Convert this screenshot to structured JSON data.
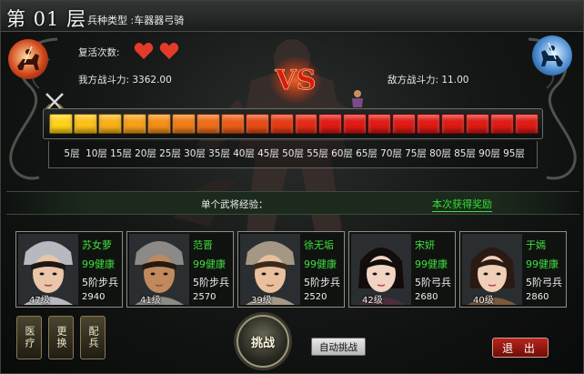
{
  "header": {
    "level_text": "第 01 层",
    "troop_type": "兵种类型 :车器器弓骑"
  },
  "battle": {
    "revive_label": "复活次数:",
    "revive_count": 2,
    "my_power": "我方战斗力: 3362.00",
    "enemy_power": "敌方战斗力: 11.00",
    "vs_text": "VS"
  },
  "progress": {
    "segment_count": 20,
    "current_floor": 1,
    "floor_labels": [
      "5层",
      "10层",
      "15层",
      "20层",
      "25层",
      "30层",
      "35层",
      "40层",
      "45层",
      "50层",
      "55层",
      "60层",
      "65层",
      "70层",
      "75层",
      "80层",
      "85层",
      "90层",
      "95层"
    ]
  },
  "experience": {
    "label": "单个武将经验：",
    "reward_link": "本次获得奖励"
  },
  "heroes": [
    {
      "name": "苏女萝",
      "health": "99健康",
      "troop": "5阶步兵",
      "power": "2940",
      "level": "47级",
      "skin": "#e9c6a9",
      "hair": "#1d1714",
      "accent": "#b8b8c0"
    },
    {
      "name": "范晋",
      "health": "99健康",
      "troop": "5阶步兵",
      "power": "2570",
      "level": "41级",
      "skin": "#c08a5e",
      "hair": "#241a12",
      "accent": "#8c8a86"
    },
    {
      "name": "徐无垢",
      "health": "99健康",
      "troop": "5阶步兵",
      "power": "2520",
      "level": "39级",
      "skin": "#e8c09d",
      "hair": "#3a2a1c",
      "accent": "#a49884"
    },
    {
      "name": "宋妍",
      "health": "99健康",
      "troop": "5阶弓兵",
      "power": "2680",
      "level": "42级",
      "skin": "#f2d4c4",
      "hair": "#120c0c",
      "accent": "#4a2f3a"
    },
    {
      "name": "于嫣",
      "health": "99健康",
      "troop": "5阶弓兵",
      "power": "2860",
      "level": "40级",
      "skin": "#f0cfb8",
      "hair": "#2a1a14",
      "accent": "#7a5a3c"
    }
  ],
  "buttons": {
    "heal": "医疗",
    "swap": "更换",
    "equip": "配兵",
    "challenge": "挑战",
    "auto_challenge": "自动挑战",
    "exit": "退 出"
  },
  "colors": {
    "bar_start": "#ffd21a",
    "bar_end": "#e01a14",
    "name_green": "#3fe03f",
    "exit_red": "#b8241a"
  },
  "icons": {
    "revive": "heart-icon",
    "marker": "soldier-icon",
    "swords": "crossed-swords-icon",
    "left_emblem": "red-cavalry-icon",
    "right_emblem": "blue-cavalry-icon"
  }
}
